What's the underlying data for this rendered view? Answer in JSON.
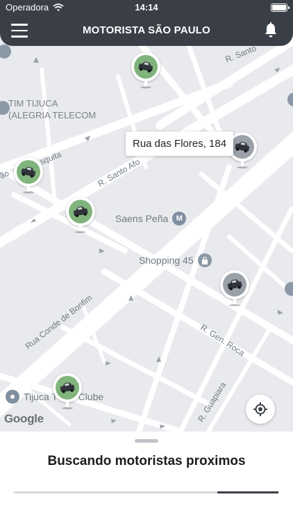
{
  "status_bar": {
    "carrier": "Operadora",
    "time": "14:14"
  },
  "header": {
    "title": "MOTORISTA SÃO PAULO",
    "menu_icon": "menu-icon",
    "bell_icon": "bell-icon"
  },
  "map": {
    "area_labels": [
      "TIM TIJUCA",
      "(ALEGRIA TELECOM"
    ],
    "road_labels": {
      "santo_short": "R. Santo",
      "mesquita": "squita",
      "ao": "ão",
      "santo_alfonso": "R. Santo Afo",
      "conde_bonfim": "Rua Conde de Bonfim",
      "gen_roca": "R. Gen. Roca",
      "guapiara": "R. Guapiara"
    },
    "pois": {
      "saens_pena": {
        "label": "Saens Peña",
        "icon": "metro-icon"
      },
      "shopping": {
        "label": "Shopping 45",
        "icon": "shopping-icon"
      },
      "tijuca_club": {
        "label": "Tijuca Tênis Clube",
        "icon": "pin-icon"
      }
    },
    "tooltip": "Rua das Flores, 184",
    "google_logo": "Google",
    "colors": {
      "map_bg": "#e9eaee",
      "road": "#ffffff",
      "car_green": "#80b47c",
      "car_grey": "#9aa1a8"
    }
  },
  "sheet": {
    "title": "Buscando motoristas proximos",
    "progress": 0.23
  },
  "colors": {
    "header_bg": "#3a3f47",
    "accent": "#3a3f47"
  }
}
